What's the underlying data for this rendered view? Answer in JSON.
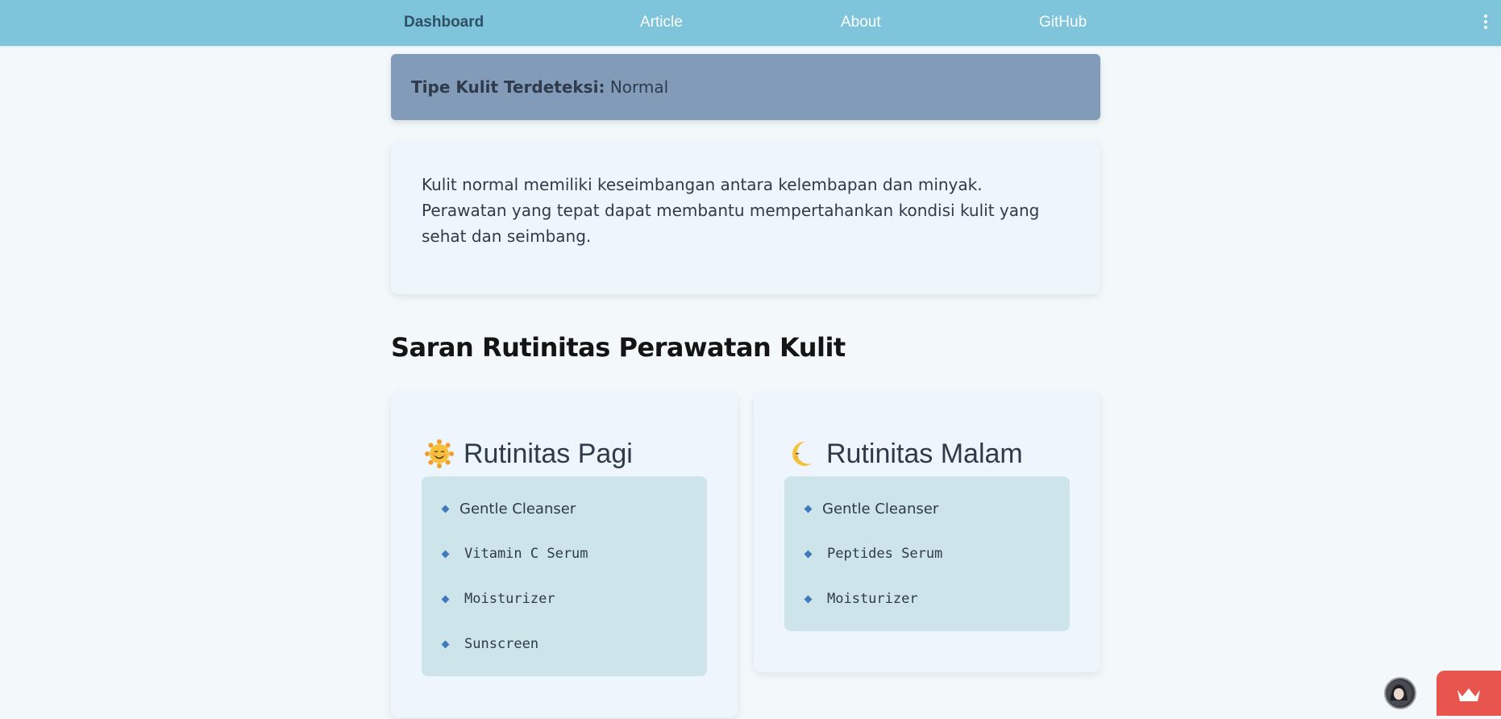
{
  "nav": {
    "items": [
      {
        "label": "Dashboard",
        "active": true
      },
      {
        "label": "Article",
        "active": false
      },
      {
        "label": "About",
        "active": false
      },
      {
        "label": "GitHub",
        "active": false
      }
    ],
    "menu_icon": "kebab-menu-icon"
  },
  "result": {
    "label": "Tipe Kulit Terdeteksi:",
    "value": "Normal"
  },
  "description": "Kulit normal memiliki keseimbangan antara kelembapan dan minyak. Perawatan yang tepat dapat membantu mempertahankan kondisi kulit yang sehat dan seimbang.",
  "section_title": "Saran Rutinitas Perawatan Kulit",
  "routines": {
    "morning": {
      "icon": "smiling-sun-emoji",
      "title": "Rutinitas Pagi",
      "items": [
        "Gentle Cleanser",
        "Vitamin C Serum",
        "Moisturizer",
        "Sunscreen"
      ]
    },
    "night": {
      "icon": "crescent-moon-emoji",
      "title": "Rutinitas Malam",
      "items": [
        "Gentle Cleanser",
        "Peptides Serum",
        "Moisturizer"
      ]
    }
  },
  "floating": {
    "avatar_icon": "avatar-icon",
    "crown_icon": "crown-icon"
  },
  "colors": {
    "navbar": "#7ec4da",
    "banner": "#819bb8",
    "card": "#eef5fc",
    "list_box": "#cce4ea",
    "bullet": "#3f79b8",
    "crown_button": "#e8554e"
  }
}
